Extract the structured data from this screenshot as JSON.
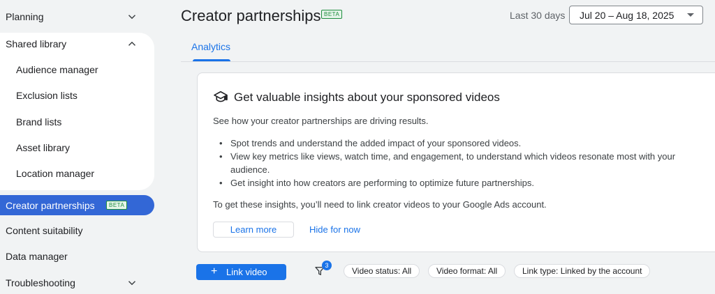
{
  "sidebar": {
    "planning": "Planning",
    "shared_library": "Shared library",
    "sub_items": [
      "Audience manager",
      "Exclusion lists",
      "Brand lists",
      "Asset library",
      "Location manager"
    ],
    "creator_partnerships": "Creator partnerships",
    "beta_badge": "BETA",
    "content_suitability": "Content suitability",
    "data_manager": "Data manager",
    "troubleshooting": "Troubleshooting",
    "active_color": "#3367d6"
  },
  "header": {
    "title": "Creator partnerships",
    "beta_badge": "BETA",
    "range_label": "Last 30 days",
    "date_range": "Jul 20 – Aug 18, 2025"
  },
  "tabs": [
    {
      "label": "Analytics",
      "selected": true
    }
  ],
  "card": {
    "icon": "graduation-cap-icon",
    "heading": "Get valuable insights about your sponsored videos",
    "intro": "See how your creator partnerships are driving results.",
    "bullets": [
      "Spot trends and understand the added impact of your sponsored videos.",
      "View key metrics like views, watch time, and engagement, to understand which videos resonate most with your audience.",
      "Get insight into how creators are performing to optimize future partnerships."
    ],
    "outro": "To get these insights, you’ll need to link creator videos to your Google Ads account.",
    "learn_more": "Learn more",
    "hide_for_now": "Hide for now"
  },
  "toolbar": {
    "link_video": "Link video",
    "plus": "+",
    "filter_count": "3",
    "chips": [
      "Video status: All",
      "Video format: All",
      "Link type: Linked by the account"
    ]
  },
  "colors": {
    "accent": "#1a73e8",
    "beta_green": "#1e8e3e"
  }
}
